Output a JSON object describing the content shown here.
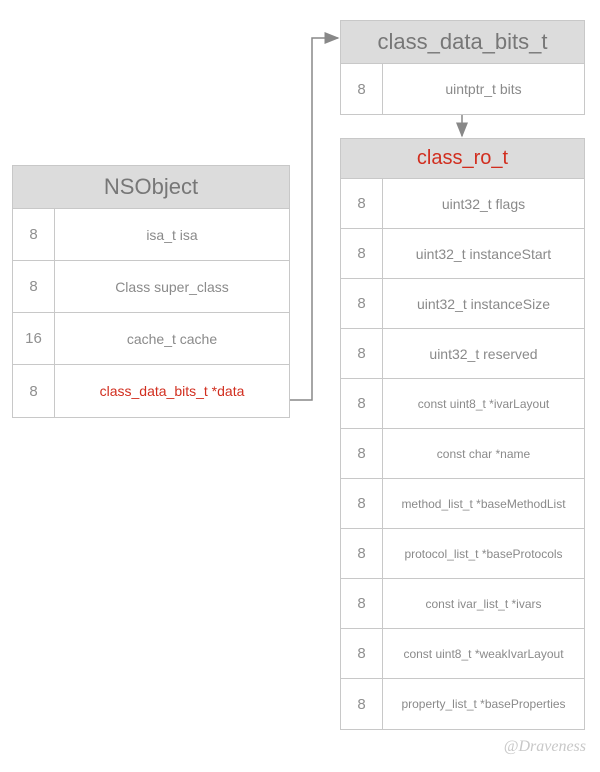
{
  "nsobject": {
    "title": "NSObject",
    "rows": [
      {
        "size": "8",
        "label": "isa_t isa",
        "red": false
      },
      {
        "size": "8",
        "label": "Class super_class",
        "red": false
      },
      {
        "size": "16",
        "label": "cache_t cache",
        "red": false
      },
      {
        "size": "8",
        "label": "class_data_bits_t *data",
        "red": true
      }
    ]
  },
  "bits": {
    "title": "class_data_bits_t",
    "rows": [
      {
        "size": "8",
        "label": "uintptr_t bits"
      }
    ]
  },
  "ro": {
    "title": "class_ro_t",
    "rows": [
      {
        "size": "8",
        "label": "uint32_t flags",
        "small": false
      },
      {
        "size": "8",
        "label": "uint32_t instanceStart",
        "small": false
      },
      {
        "size": "8",
        "label": "uint32_t instanceSize",
        "small": false
      },
      {
        "size": "8",
        "label": "uint32_t reserved",
        "small": false
      },
      {
        "size": "8",
        "label": "const uint8_t *ivarLayout",
        "small": true
      },
      {
        "size": "8",
        "label": "const char *name",
        "small": true
      },
      {
        "size": "8",
        "label": "method_list_t *baseMethodList",
        "small": true
      },
      {
        "size": "8",
        "label": "protocol_list_t *baseProtocols",
        "small": true
      },
      {
        "size": "8",
        "label": "const ivar_list_t *ivars",
        "small": true
      },
      {
        "size": "8",
        "label": "const uint8_t *weakIvarLayout",
        "small": true
      },
      {
        "size": "8",
        "label": "property_list_t *baseProperties",
        "small": true
      }
    ]
  },
  "watermark": "@Draveness"
}
